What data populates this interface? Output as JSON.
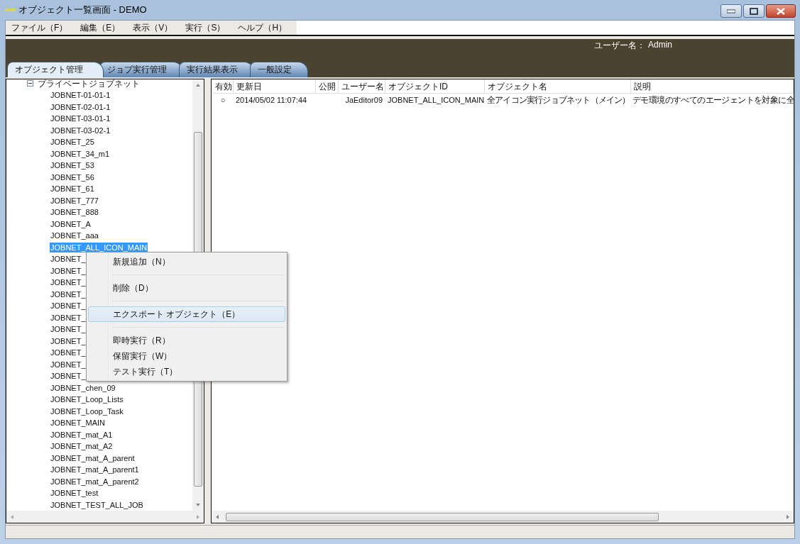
{
  "window": {
    "title": "オブジェクト一覧画面 - DEMO",
    "logo": "Jam"
  },
  "menu_bar": [
    "ファイル（F）",
    "編集（E）",
    "表示（V）",
    "実行（S）",
    "ヘルプ（H）"
  ],
  "header": {
    "user_label": "ユーザー名：",
    "user": "Admin"
  },
  "tabs": [
    {
      "label": "オブジェクト管理",
      "selected": true
    },
    {
      "label": "ジョブ実行管理",
      "selected": false
    },
    {
      "label": "実行結果表示",
      "selected": false
    },
    {
      "label": "一般設定",
      "selected": false
    }
  ],
  "tree": {
    "label": "プライベートジョブネット",
    "expanded": true,
    "children": [
      {
        "label": "JOBNET-01-01-1",
        "selected": false
      },
      {
        "label": "JOBNET-02-01-1",
        "selected": false
      },
      {
        "label": "JOBNET-03-01-1",
        "selected": false
      },
      {
        "label": "JOBNET-03-02-1",
        "selected": false
      },
      {
        "label": "JOBNET_25",
        "selected": false
      },
      {
        "label": "JOBNET_34_m1",
        "selected": false
      },
      {
        "label": "JOBNET_53",
        "selected": false
      },
      {
        "label": "JOBNET_56",
        "selected": false
      },
      {
        "label": "JOBNET_61",
        "selected": false
      },
      {
        "label": "JOBNET_777",
        "selected": false
      },
      {
        "label": "JOBNET_888",
        "selected": false
      },
      {
        "label": "JOBNET_A",
        "selected": false
      },
      {
        "label": "JOBNET_aaa",
        "selected": false
      },
      {
        "label": "JOBNET_ALL_ICON_MAIN",
        "selected": true
      },
      {
        "label": "JOBNET_",
        "selected": false
      },
      {
        "label": "JOBNET_",
        "selected": false
      },
      {
        "label": "JOBNET_",
        "selected": false
      },
      {
        "label": "JOBNET_",
        "selected": false
      },
      {
        "label": "JOBNET_",
        "selected": false
      },
      {
        "label": "JOBNET_",
        "selected": false
      },
      {
        "label": "JOBNET_",
        "selected": false
      },
      {
        "label": "JOBNET_",
        "selected": false
      },
      {
        "label": "JOBNET_",
        "selected": false
      },
      {
        "label": "JOBNET_",
        "selected": false
      },
      {
        "label": "JOBNET_",
        "selected": false
      },
      {
        "label": "JOBNET_chen_09",
        "selected": false
      },
      {
        "label": "JOBNET_Loop_Lists",
        "selected": false
      },
      {
        "label": "JOBNET_Loop_Task",
        "selected": false
      },
      {
        "label": "JOBNET_MAIN",
        "selected": false
      },
      {
        "label": "JOBNET_mat_A1",
        "selected": false
      },
      {
        "label": "JOBNET_mat_A2",
        "selected": false
      },
      {
        "label": "JOBNET_mat_A_parent",
        "selected": false
      },
      {
        "label": "JOBNET_mat_A_parent1",
        "selected": false
      },
      {
        "label": "JOBNET_mat_A_parent2",
        "selected": false
      },
      {
        "label": "JOBNET_test",
        "selected": false
      },
      {
        "label": "JOBNET_TEST_ALL_JOB",
        "selected": false
      }
    ]
  },
  "table": {
    "columns": [
      "有効",
      "更新日",
      "公開",
      "ユーザー名",
      "オブジェクトID",
      "オブジェクト名",
      "説明"
    ],
    "rows": [
      [
        "○",
        "2014/05/02 11:07:44",
        "",
        "JaEditor09",
        "JOBNET_ALL_ICON_MAIN",
        "全アイコン実行ジョブネット（メイン）",
        "デモ環境のすべてのエージェントを対象に全"
      ]
    ]
  },
  "context_menu": [
    {
      "kind": "item",
      "label": "新規追加（N）",
      "highlighted": false
    },
    {
      "kind": "separator"
    },
    {
      "kind": "item",
      "label": "削除（D）",
      "highlighted": false
    },
    {
      "kind": "separator"
    },
    {
      "kind": "item",
      "label": "エクスポート オブジェクト（E）",
      "highlighted": true
    },
    {
      "kind": "separator"
    },
    {
      "kind": "item",
      "label": "即時実行（R）",
      "highlighted": false
    },
    {
      "kind": "item",
      "label": "保留実行（W）",
      "highlighted": false
    },
    {
      "kind": "item",
      "label": "テスト実行（T）",
      "highlighted": false
    }
  ]
}
